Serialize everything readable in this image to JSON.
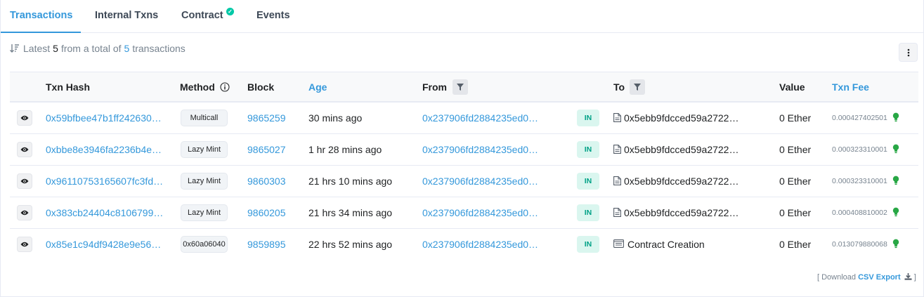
{
  "tabs": [
    {
      "label": "Transactions"
    },
    {
      "label": "Internal Txns"
    },
    {
      "label": "Contract"
    },
    {
      "label": "Events"
    }
  ],
  "summary": {
    "prefix": "Latest",
    "latest": "5",
    "middle": "from a total of",
    "total": "5",
    "suffix": "transactions"
  },
  "table": {
    "headers": {
      "hash": "Txn Hash",
      "method": "Method",
      "block": "Block",
      "age": "Age",
      "from": "From",
      "to": "To",
      "value": "Value",
      "fee": "Txn Fee"
    },
    "rows": [
      {
        "hash": "0x59bfbee47b1ff242630…",
        "method": "Multicall",
        "block": "9865259",
        "age": "30 mins ago",
        "from": "0x237906fd2884235ed0…",
        "direction": "IN",
        "to": "0x5ebb9fdcced59a2722…",
        "to_type": "contract",
        "value": "0 Ether",
        "fee": "0.000427402501"
      },
      {
        "hash": "0xbbe8e3946fa2236b4e…",
        "method": "Lazy Mint",
        "block": "9865027",
        "age": "1 hr 28 mins ago",
        "from": "0x237906fd2884235ed0…",
        "direction": "IN",
        "to": "0x5ebb9fdcced59a2722…",
        "to_type": "contract",
        "value": "0 Ether",
        "fee": "0.000323310001"
      },
      {
        "hash": "0x96110753165607fc3fd…",
        "method": "Lazy Mint",
        "block": "9860303",
        "age": "21 hrs 10 mins ago",
        "from": "0x237906fd2884235ed0…",
        "direction": "IN",
        "to": "0x5ebb9fdcced59a2722…",
        "to_type": "contract",
        "value": "0 Ether",
        "fee": "0.000323310001"
      },
      {
        "hash": "0x383cb24404c8106799…",
        "method": "Lazy Mint",
        "block": "9860205",
        "age": "21 hrs 34 mins ago",
        "from": "0x237906fd2884235ed0…",
        "direction": "IN",
        "to": "0x5ebb9fdcced59a2722…",
        "to_type": "contract",
        "value": "0 Ether",
        "fee": "0.000408810002"
      },
      {
        "hash": "0x85e1c94df9428e9e56…",
        "method": "0x60a06040",
        "block": "9859895",
        "age": "22 hrs 52 mins ago",
        "from": "0x237906fd2884235ed0…",
        "direction": "IN",
        "to": "Contract Creation",
        "to_type": "creation",
        "value": "0 Ether",
        "fee": "0.013079880068"
      }
    ]
  },
  "footer": {
    "open": "[ Download",
    "csv": "CSV Export",
    "close": "]"
  },
  "colors": {
    "accent": "#3498db",
    "in_badge_bg": "#daf6ef",
    "in_badge_text": "#00a186",
    "verified": "#00c9a7",
    "bulb": "#28a745"
  },
  "icons": {
    "sort": "sort-amount-down-icon",
    "more": "vertical-ellipsis-icon",
    "info": "info-circle-icon",
    "filter": "filter-icon",
    "eye": "eye-icon",
    "file": "file-icon",
    "creation": "contract-creation-icon",
    "bulb": "lightbulb-icon",
    "download": "download-icon",
    "verified": "check-circle-icon"
  }
}
